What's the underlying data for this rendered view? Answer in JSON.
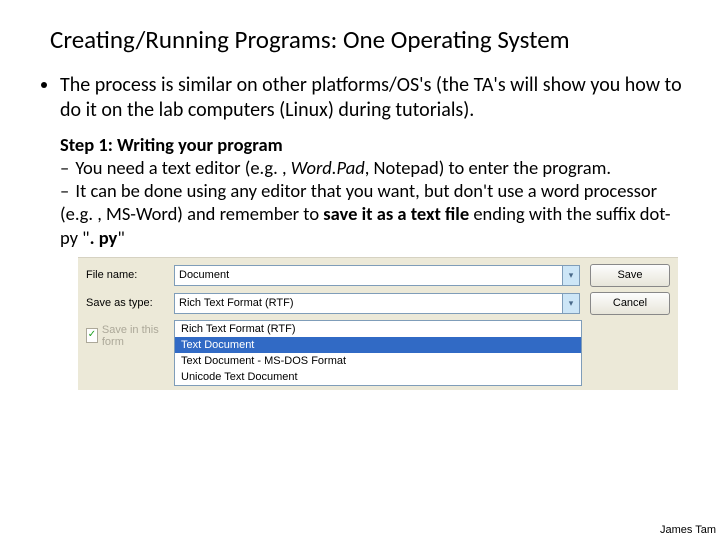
{
  "title": "Creating/Running Programs: One Operating System",
  "bullet1": "The process is similar on other platforms/OS's (the TA's will show you how to do it on the lab computers (Linux) during tutorials).",
  "step": {
    "heading": "Step 1: Writing your program",
    "line1_pre": "You need a text editor (e.g. , ",
    "line1_em": "Word.Pad",
    "line1_post": ", Notepad) to enter the program.",
    "line2_pre": "It can be done using any editor that you want, but don't use a word processor (e.g. , MS-Word) and remember to ",
    "line2_bold": "save it as a text file ",
    "line2_mid": "ending with the suffix dot-py \"",
    "line2_code": ". py",
    "line2_end": "\""
  },
  "dlg": {
    "filename_label": "File name:",
    "filename_value": "Document",
    "savetype_label": "Save as type:",
    "savetype_value": "Rich Text Format (RTF)",
    "save_btn": "Save",
    "cancel_btn": "Cancel",
    "checkbox_label": "Save in this form",
    "options": {
      "o0": "Rich Text Format (RTF)",
      "o1": "Text Document",
      "o2": "Text Document - MS-DOS Format",
      "o3": "Unicode Text Document"
    }
  },
  "footer": "James Tam"
}
